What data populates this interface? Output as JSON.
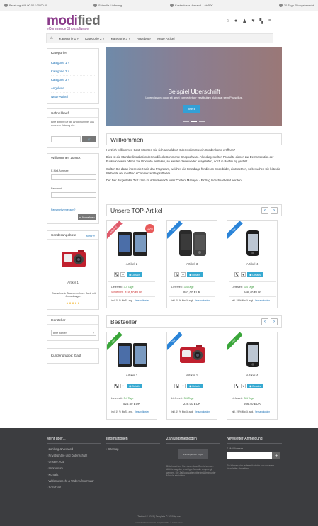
{
  "topbar": {
    "items": [
      "Beratung +49 00 00 / 00 00 00",
      "Schnelle Lieferung",
      "Kostenloser Versand – ab 50€",
      "30 Tage Rückgaberecht"
    ]
  },
  "logo": {
    "main_a": "modi",
    "main_b": "fied",
    "sub": "eCommerce Shopsoftware"
  },
  "header_icons": [
    "home-icon",
    "globe-icon",
    "user-icon",
    "heart-icon",
    "cart-icon",
    "menu-icon"
  ],
  "nav": {
    "home_icon": "home-icon",
    "items": [
      "Kategorie 1 ˅",
      "Kategorie 2 ˅",
      "Kategorie 3 ˅",
      "Angebote",
      "Neue Artikel"
    ]
  },
  "sidebar": {
    "categories": {
      "title": "Kategorien",
      "items": [
        "Kategorie 1 ˅",
        "Kategorie 2 ˅",
        "Kategorie 3 ˅",
        "Angebote",
        "Neue Artikel"
      ]
    },
    "quickbuy": {
      "title": "Schnellkauf",
      "text": "Bitte geben Sie die Artikelnummer aus unserem Katalog ein.",
      "button": "🛒"
    },
    "welcome": {
      "title": "Willkommen zurück!",
      "email_label": "E-Mail-Adresse",
      "password_label": "Passwort",
      "forgot": "Passwort vergessen?",
      "login_button": "Anmelden"
    },
    "offers": {
      "title": "Sonderangebote",
      "more": "Mehr »",
      "product_name": "Artikel 1",
      "product_text": "Das schnelle Taschenrechner. Dank mit Anmerkungen.",
      "stars": "★★★★★"
    },
    "manufacturers": {
      "title": "Hersteller",
      "select": "Bitte wählen"
    },
    "customer_group": {
      "title": "Kundengruppe: Gast"
    }
  },
  "slider": {
    "heading": "Beispiel Überschrift",
    "text": "Lorem ipsum dolor sit amet consectetuer vestibulum platea at sem Phasellus.",
    "button": "Mehr"
  },
  "welcome_section": {
    "title": "Willkommen",
    "p1": "Herzlich willkommen Gast! Möchten Sie sich anmelden? Oder wollen Sie ein Kundenkonto eröffnen?",
    "p2": "Dies ist die Standardinstallation der modified eCommerce Shopsoftware. Alle dargestellten Produkte dienen zur Demonstration der Funktionsweise. Wenn Sie Produkte bestellen, so werden diese weder ausgeliefert, noch in Rechnung gestellt.",
    "p3": "Sollten Sie daran interessiert sein das Programm, welches die Grundlage für diesen Shop bildet, einzusetzen, so besuchen Sie bitte die Webseite der modified eCommerce Shopsoftware.",
    "p4": "Der hier dargestellte Text kann im Adminbereich unter Content Manager - Eintrag Indexbearbeitet werden."
  },
  "top_products": {
    "title": "Unsere TOP-Artikel",
    "prev": "‹",
    "next": "›",
    "items": [
      {
        "name": "Artikel 2",
        "ribbon": "Angebot",
        "ribbon_color": "#e05a6a",
        "badge": "-22%",
        "delivery_label": "Lieferzeit:",
        "delivery": "3-4 Tage",
        "price_old": "Sonderpreis",
        "price": "416,50 EUR",
        "tax": "inkl. 19 % MwSt. zzgl.",
        "shipping": "Versandkosten",
        "details": "Details"
      },
      {
        "name": "Artikel 3",
        "ribbon": "Top",
        "ribbon_color": "#2a84d8",
        "badge": "",
        "delivery_label": "Lieferzeit:",
        "delivery": "3-4 Tage",
        "price_old": "",
        "price": "952,00 EUR",
        "tax": "inkl. 19 % MwSt. zzgl.",
        "shipping": "Versandkosten",
        "details": "Details"
      },
      {
        "name": "Artikel 4",
        "ribbon": "Top",
        "ribbon_color": "#2a84d8",
        "badge": "",
        "delivery_label": "Lieferzeit:",
        "delivery": "3-4 Tage",
        "price_old": "",
        "price": "666,40 EUR",
        "tax": "inkl. 19 % MwSt. zzgl.",
        "shipping": "Versandkosten",
        "details": "Details"
      }
    ]
  },
  "bestseller": {
    "title": "Bestseller",
    "prev": "‹",
    "next": "›",
    "items": [
      {
        "name": "Artikel 2",
        "ribbon": "Neu",
        "ribbon_color": "#3aa63a",
        "delivery_label": "Lieferzeit:",
        "delivery": "3-4 Tage",
        "price": "525,50 EUR",
        "tax": "inkl. 19 % MwSt. zzgl.",
        "shipping": "Versandkosten",
        "details": "Details"
      },
      {
        "name": "Artikel 1",
        "ribbon": "Top",
        "ribbon_color": "#2a84d8",
        "delivery_label": "Lieferzeit:",
        "delivery": "3-4 Tage",
        "price": "228,00 EUR",
        "tax": "inkl. 19 % MwSt. zzgl.",
        "shipping": "Versandkosten",
        "details": "Details"
      },
      {
        "name": "Artikel 4",
        "ribbon": "Neu",
        "ribbon_color": "#3aa63a",
        "delivery_label": "Lieferzeit:",
        "delivery": "3-4 Tage",
        "price": "666,40 EUR",
        "tax": "inkl. 19 % MwSt. zzgl.",
        "shipping": "Versandkosten",
        "details": "Details"
      }
    ]
  },
  "footer": {
    "col1": {
      "title": "Mehr über...",
      "items": [
        "Zahlung & Versand",
        "Privatsphäre und Datenschutz",
        "Unsere AGB",
        "Impressum",
        "Kontakt",
        "Widerrufsrecht & Widerrufsformular",
        "Sofortzeit"
      ]
    },
    "col2": {
      "title": "Informationen",
      "items": [
        "Sitemap"
      ]
    },
    "col3": {
      "title": "Zahlungsmethoden",
      "logo_text": "Zahlungsarten Logos",
      "text": "Bitte beachten Sie, dass diese Bereiche nach Aktivierung der jeweiligen Module angezeigt werden. Die Zahlungsarten bitte im Admin unter Module einrichten."
    },
    "col4": {
      "title": "Newsletter-Anmeldung",
      "email_label": "E-Mail-Adresse",
      "text": "Sie können sich jederzeit wieder von unserem Newsletter abmelden."
    },
    "copyright": "Textfeld © 2015 | Template © 2015 by me",
    "powered": "modified eCommerce Shopsoftware © 2009-2015"
  }
}
